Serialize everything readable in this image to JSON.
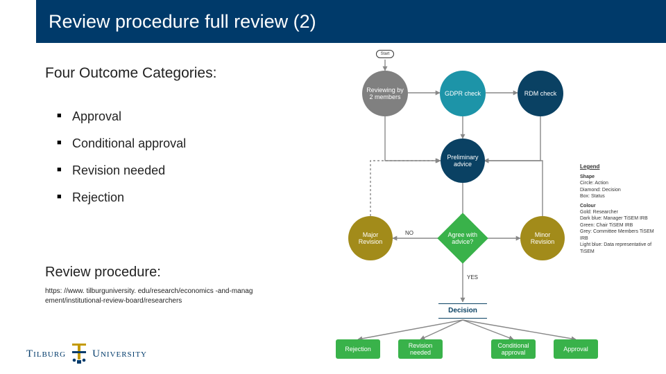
{
  "title": "Review procedure full review (2)",
  "subtitle": "Four Outcome Categories:",
  "bullets": [
    "Approval",
    "Conditional approval",
    "Revision needed",
    "Rejection"
  ],
  "review_label": "Review procedure:",
  "url": "https: //www. tilburguniversity. edu/research/economics -and-management/institutional-review-board/researchers",
  "logo": {
    "left": "Tilburg",
    "right": "University"
  },
  "flow": {
    "start": "Start",
    "reviewing": "Reviewing by 2 members",
    "gdpr": "GDPR check",
    "rdm": "RDM check",
    "prelim": "Preliminary advice",
    "major": "Major Revision",
    "agree": "Agree with advice?",
    "minor": "Minor Revision",
    "decision": "Decision",
    "outcomes": [
      "Rejection",
      "Revision needed",
      "Conditional approval",
      "Approval"
    ],
    "no": "NO",
    "yes": "YES"
  },
  "legend": {
    "title": "Legend",
    "shape_h": "Shape",
    "shapes": [
      "Circle: Action",
      "Diamond: Decision",
      "Box: Status"
    ],
    "colour_h": "Colour",
    "colours": [
      "Gold: Researcher",
      "Dark blue: Manager TiSEM IRB",
      "Green: Chair TiSEM IRB",
      "Grey: Committee Members TiSEM IRB",
      "Light blue: Data representative of TiSEM"
    ]
  }
}
